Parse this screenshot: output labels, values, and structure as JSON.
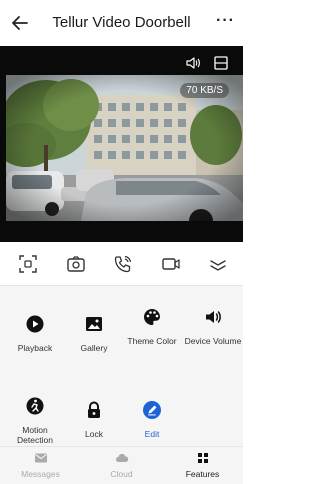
{
  "header": {
    "title": "Tellur Video Doorbell",
    "more": "···"
  },
  "video": {
    "bitrate": "70 KB/S"
  },
  "features": [
    {
      "label": "Playback"
    },
    {
      "label": "Gallery"
    },
    {
      "label": "Theme Color"
    },
    {
      "label": "Device Volume"
    },
    {
      "label": "Motion Detection"
    },
    {
      "label": "Lock"
    },
    {
      "label": "Edit"
    }
  ],
  "tabs": [
    {
      "label": "Messages"
    },
    {
      "label": "Cloud"
    },
    {
      "label": "Features"
    }
  ],
  "colors": {
    "accent": "#1e63d6",
    "video_bg": "#0a0a0a",
    "panel_bg": "#f5f5f5"
  }
}
